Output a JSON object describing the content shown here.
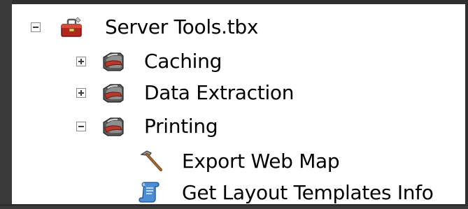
{
  "tree": {
    "root": {
      "label": "Server Tools.tbx",
      "icon": "toolbox-red-icon",
      "expanded": true
    },
    "toolsets": [
      {
        "label": "Caching",
        "icon": "toolset-icon",
        "expanded": false
      },
      {
        "label": "Data Extraction",
        "icon": "toolset-icon",
        "expanded": false
      },
      {
        "label": "Printing",
        "icon": "toolset-icon",
        "expanded": true
      }
    ],
    "tools": [
      {
        "label": "Export Web Map",
        "icon": "hammer-tool-icon"
      },
      {
        "label": "Get Layout Templates Info",
        "icon": "script-tool-icon"
      }
    ]
  }
}
